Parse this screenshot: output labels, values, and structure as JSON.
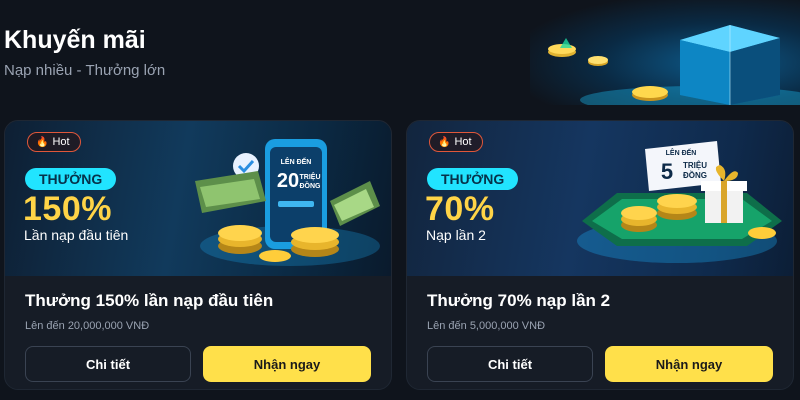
{
  "header": {
    "title": "Khuyến mãi",
    "subtitle": "Nạp nhiều - Thưởng lớn"
  },
  "promotions": [
    {
      "badge": "Hot",
      "bonus_label": "THƯỞNG",
      "bonus_percent": "150%",
      "bonus_caption": "Lần nạp đầu tiên",
      "art_top": "LÊN ĐẾN",
      "art_amount": "20",
      "art_unit_1": "TRIỆU",
      "art_unit_2": "ĐỒNG",
      "title": "Thưởng 150% lần nạp đầu tiên",
      "subtitle": "Lên đến 20,000,000 VNĐ",
      "detail_label": "Chi tiết",
      "claim_label": "Nhận ngay"
    },
    {
      "badge": "Hot",
      "bonus_label": "THƯỞNG",
      "bonus_percent": "70%",
      "bonus_caption": "Nạp lần 2",
      "art_top": "LÊN ĐẾN",
      "art_amount": "5",
      "art_unit_1": "TRIỆU",
      "art_unit_2": "ĐỒNG",
      "title": "Thưởng 70% nạp lần 2",
      "subtitle": "Lên đến 5,000,000 VNĐ",
      "detail_label": "Chi tiết",
      "claim_label": "Nhận ngay"
    }
  ],
  "colors": {
    "background": "#0f141c",
    "card": "#161c26",
    "accent_yellow": "#ffe04a",
    "bonus_pill": "#21e4ff",
    "bonus_text": "#ffd447",
    "hot_border": "#e0573a"
  },
  "icons": [
    "flame-icon",
    "checkmark-icon",
    "phone-icon",
    "banknote-icon",
    "coin-stack-icon",
    "gift-box-icon"
  ]
}
